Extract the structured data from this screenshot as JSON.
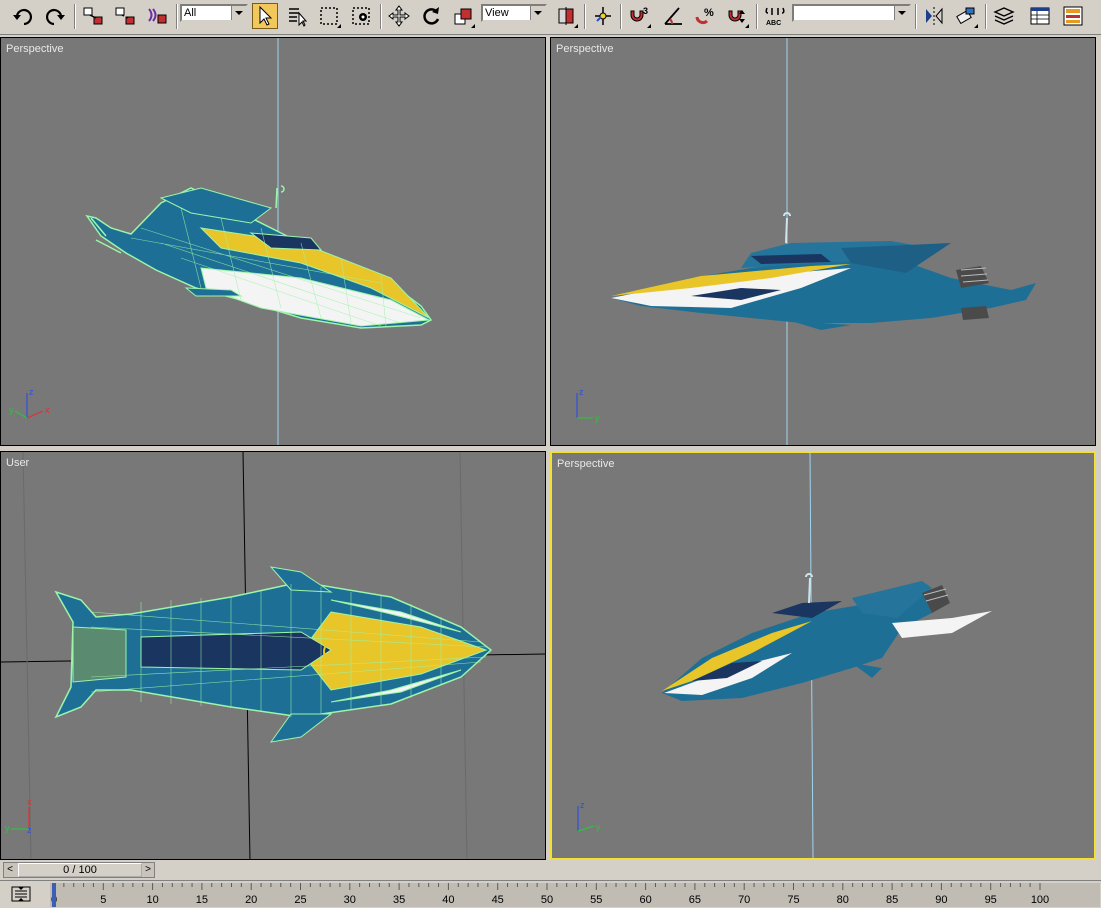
{
  "toolbar": {
    "selection_filter": "All",
    "reference_coord": "View",
    "named_selection": "",
    "icons": [
      "undo-icon",
      "redo-icon",
      "select-and-link-icon",
      "unlink-selection-icon",
      "bind-space-warp-icon",
      "select-object-icon",
      "select-by-name-icon",
      "rectangular-selection-icon",
      "window-crossing-icon",
      "select-and-move-icon",
      "select-and-rotate-icon",
      "select-and-scale-icon",
      "use-pivot-center-icon",
      "select-and-manipulate-icon",
      "snaps-toggle-icon",
      "angle-snap-icon",
      "percent-snap-icon",
      "spinner-snap-icon",
      "edit-named-selection-icon",
      "mirror-icon",
      "align-icon",
      "layer-manager-icon",
      "curve-editor-icon",
      "schematic-view-icon"
    ]
  },
  "viewports": [
    {
      "label": "Perspective",
      "active": false,
      "display": "wireframe-on-shaded"
    },
    {
      "label": "Perspective",
      "active": false,
      "display": "smooth-shaded"
    },
    {
      "label": "User",
      "active": false,
      "display": "wireframe-on-shaded"
    },
    {
      "label": "Perspective",
      "active": true,
      "display": "smooth-shaded"
    }
  ],
  "axis_tripod": {
    "x": "x",
    "y": "y",
    "z": "z"
  },
  "time_slider": {
    "frame_display": "0 / 100",
    "prev": "<",
    "next": ">"
  },
  "track_bar": {
    "ticks": [
      "0",
      "5",
      "10",
      "15",
      "20",
      "25",
      "30",
      "35",
      "40",
      "45",
      "50",
      "55",
      "60",
      "65",
      "70",
      "75",
      "80",
      "85",
      "90",
      "95",
      "100"
    ]
  },
  "colors": {
    "viewport_bg": "#787878",
    "active_viewport_border": "#f2e032",
    "hull_blue": "#1e6f95",
    "hull_yellow": "#e8c62a",
    "hull_white": "#f4f4f4",
    "wire_green": "#9cf5a8"
  }
}
